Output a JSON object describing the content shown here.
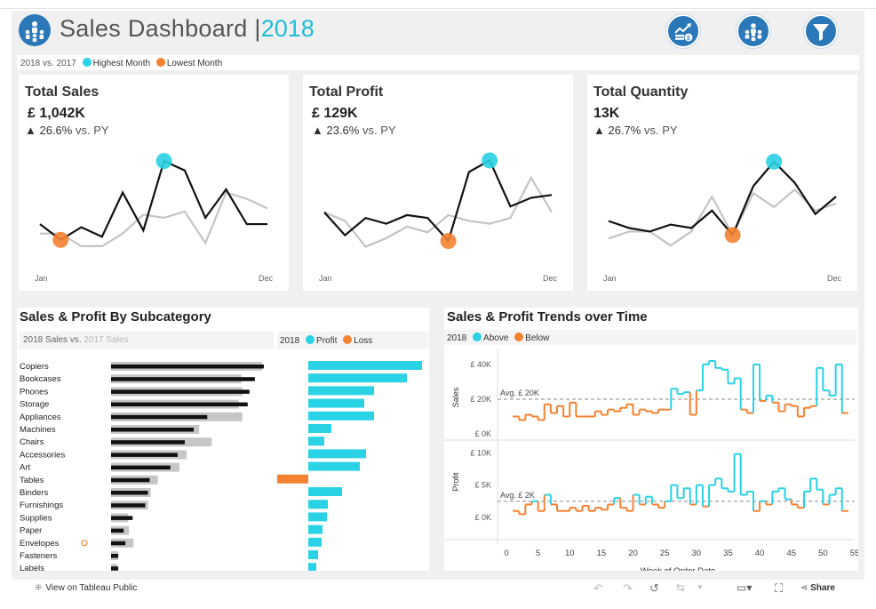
{
  "header": {
    "title": "Sales Dashboard |",
    "year": "2018",
    "legend_prefix": "2018 vs. 2017",
    "legend_high": "Highest Month",
    "legend_low": "Lowest Month",
    "buttons": [
      "sales-chart-icon",
      "team-icon",
      "filter-icon"
    ]
  },
  "colors": {
    "cyan": "#29d2e4",
    "orange": "#f58231",
    "black": "#111111",
    "gray": "#c4c4c4",
    "accent": "#20bcd8"
  },
  "kpis": [
    {
      "title": "Total Sales",
      "value": "£ 1,042K",
      "delta": "▲ 26.6%",
      "vs": "vs. PY",
      "x_start": "Jan",
      "x_end": "Dec",
      "cur": [
        45,
        40,
        44,
        41,
        55,
        43,
        65,
        62,
        47,
        56,
        45,
        45
      ],
      "prev": [
        42,
        42,
        38,
        38,
        42,
        48,
        47,
        49,
        39,
        55,
        53,
        50
      ]
    },
    {
      "title": "Total Profit",
      "value": "£ 129K",
      "delta": "▲ 23.6%",
      "vs": "vs. PY",
      "x_start": "Jan",
      "x_end": "Dec",
      "cur": [
        48,
        40,
        46,
        44,
        47,
        46,
        38,
        62,
        66,
        50,
        53,
        54
      ],
      "prev": [
        48,
        45,
        36,
        39,
        43,
        41,
        47,
        45,
        44,
        46,
        60,
        48
      ]
    },
    {
      "title": "Total Quantity",
      "value": "13K",
      "delta": "▲ 26.7%",
      "vs": "vs. PY",
      "x_start": "Jan",
      "x_end": "Dec",
      "cur": [
        45,
        43,
        42,
        44,
        43,
        48,
        41,
        55,
        62,
        56,
        47,
        52
      ],
      "prev": [
        40,
        42,
        42,
        38,
        42,
        52,
        41,
        53,
        49,
        54,
        48,
        50
      ]
    }
  ],
  "subcategory": {
    "title": "Sales & Profit By Subcategory",
    "legend_left_2018": "2018 Sales vs.",
    "legend_left_2017": "2017 Sales",
    "legend_right_year": "2018",
    "legend_profit": "Profit",
    "legend_loss": "Loss",
    "rows": [
      {
        "name": "Copiers",
        "sales2018": 170,
        "sales2017": 168,
        "profit": 128
      },
      {
        "name": "Bookcases",
        "sales2018": 160,
        "sales2017": 145,
        "profit": 111
      },
      {
        "name": "Phones",
        "sales2018": 154,
        "sales2017": 146,
        "profit": 74
      },
      {
        "name": "Storage",
        "sales2018": 152,
        "sales2017": 142,
        "profit": 63
      },
      {
        "name": "Appliances",
        "sales2018": 107,
        "sales2017": 146,
        "profit": 74
      },
      {
        "name": "Machines",
        "sales2018": 92,
        "sales2017": 98,
        "profit": 26
      },
      {
        "name": "Chairs",
        "sales2018": 82,
        "sales2017": 112,
        "profit": 18
      },
      {
        "name": "Accessories",
        "sales2018": 74,
        "sales2017": 84,
        "profit": 65
      },
      {
        "name": "Art",
        "sales2018": 66,
        "sales2017": 76,
        "profit": 58
      },
      {
        "name": "Tables",
        "sales2018": 43,
        "sales2017": 52,
        "profit": -35
      },
      {
        "name": "Binders",
        "sales2018": 41,
        "sales2017": 44,
        "profit": 38
      },
      {
        "name": "Furnishings",
        "sales2018": 38,
        "sales2017": 41,
        "profit": 22
      },
      {
        "name": "Supplies",
        "sales2018": 24,
        "sales2017": 19,
        "profit": 21
      },
      {
        "name": "Paper",
        "sales2018": 14,
        "sales2017": 20,
        "profit": 16
      },
      {
        "name": "Envelopes",
        "sales2018": 16,
        "sales2017": 25,
        "profit": 15
      },
      {
        "name": "Fasteners",
        "sales2018": 8,
        "sales2017": 8,
        "profit": 11
      },
      {
        "name": "Labels",
        "sales2018": 8,
        "sales2017": 7,
        "profit": 9
      }
    ]
  },
  "trends": {
    "title": "Sales & Profit Trends over Time",
    "legend_year": "2018",
    "legend_above": "Above",
    "legend_below": "Below",
    "x_label": "Week of Order Date",
    "x_ticks": [
      "0",
      "5",
      "10",
      "15",
      "20",
      "25",
      "30",
      "35",
      "40",
      "45",
      "50",
      "55"
    ],
    "sales": {
      "ylabel": "Sales",
      "y_ticks": [
        "£ 40K",
        "£ 20K",
        "£ 0K"
      ],
      "avg_label": "Avg. £ 20K",
      "avg": 20,
      "ymax": 42,
      "values": [
        10,
        8,
        11,
        10,
        8,
        17,
        12,
        16,
        10,
        18,
        10,
        10,
        10,
        13,
        11,
        14,
        13,
        15,
        17,
        11,
        14,
        13,
        12,
        14,
        14,
        26,
        23,
        24,
        11,
        25,
        40,
        42,
        38,
        37,
        29,
        32,
        14,
        12,
        40,
        19,
        22,
        18,
        13,
        17,
        16,
        10,
        15,
        16,
        38,
        25,
        22,
        40,
        12
      ]
    },
    "profit": {
      "ylabel": "Profit",
      "y_ticks": [
        "£ 10K",
        "£ 5K",
        "£ 0K"
      ],
      "avg_label": "Avg. £ 2K",
      "avg": 2.5,
      "ymax": 11,
      "values": [
        1,
        0.5,
        2,
        2.5,
        1,
        3.5,
        2,
        1,
        1,
        1.5,
        1,
        1.8,
        1,
        1.5,
        1.2,
        2,
        3,
        1.5,
        1,
        3.5,
        2,
        3.2,
        2,
        1.5,
        2.5,
        5,
        3,
        4.5,
        2,
        5,
        1.7,
        5,
        6,
        4.5,
        4,
        9.8,
        3.5,
        4,
        1,
        2.5,
        2,
        4,
        4.5,
        2.8,
        2,
        1.5,
        4,
        6,
        4.3,
        2,
        3.5,
        4.5,
        1
      ]
    }
  },
  "footer": {
    "view_label": "View on Tableau Public",
    "share_label": "Share"
  }
}
